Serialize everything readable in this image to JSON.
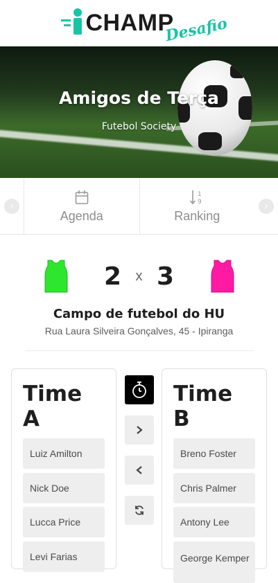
{
  "brand": {
    "name": "CHAMP",
    "tagline": "Desafio",
    "accent_color": "#19c4a6"
  },
  "event": {
    "title": "Amigos de Terça",
    "subtitle": "Futebol Society"
  },
  "tabs": [
    {
      "label": "Agenda",
      "icon": "calendar-icon"
    },
    {
      "label": "Ranking",
      "icon": "sort-numeric-icon"
    }
  ],
  "match": {
    "home_score": "2",
    "separator": "x",
    "away_score": "3",
    "home_jersey_color": "#2ee62e",
    "away_jersey_color": "#ff1aa3",
    "venue": "Campo de futebol do HU",
    "address": "Rua Laura Silveira Gonçalves, 45 - Ipiranga"
  },
  "team_a": {
    "name": "Time A",
    "players": [
      "Luiz Amilton",
      "Nick Doe",
      "Lucca Price",
      "Levi Farias"
    ]
  },
  "team_b": {
    "name": "Time B",
    "players": [
      "Breno Foster",
      "Chris Palmer",
      "Antony Lee",
      "George Kemper"
    ]
  },
  "controls": [
    {
      "icon": "stopwatch-icon"
    },
    {
      "icon": "chevron-right-icon"
    },
    {
      "icon": "chevron-left-icon"
    },
    {
      "icon": "refresh-icon"
    }
  ]
}
